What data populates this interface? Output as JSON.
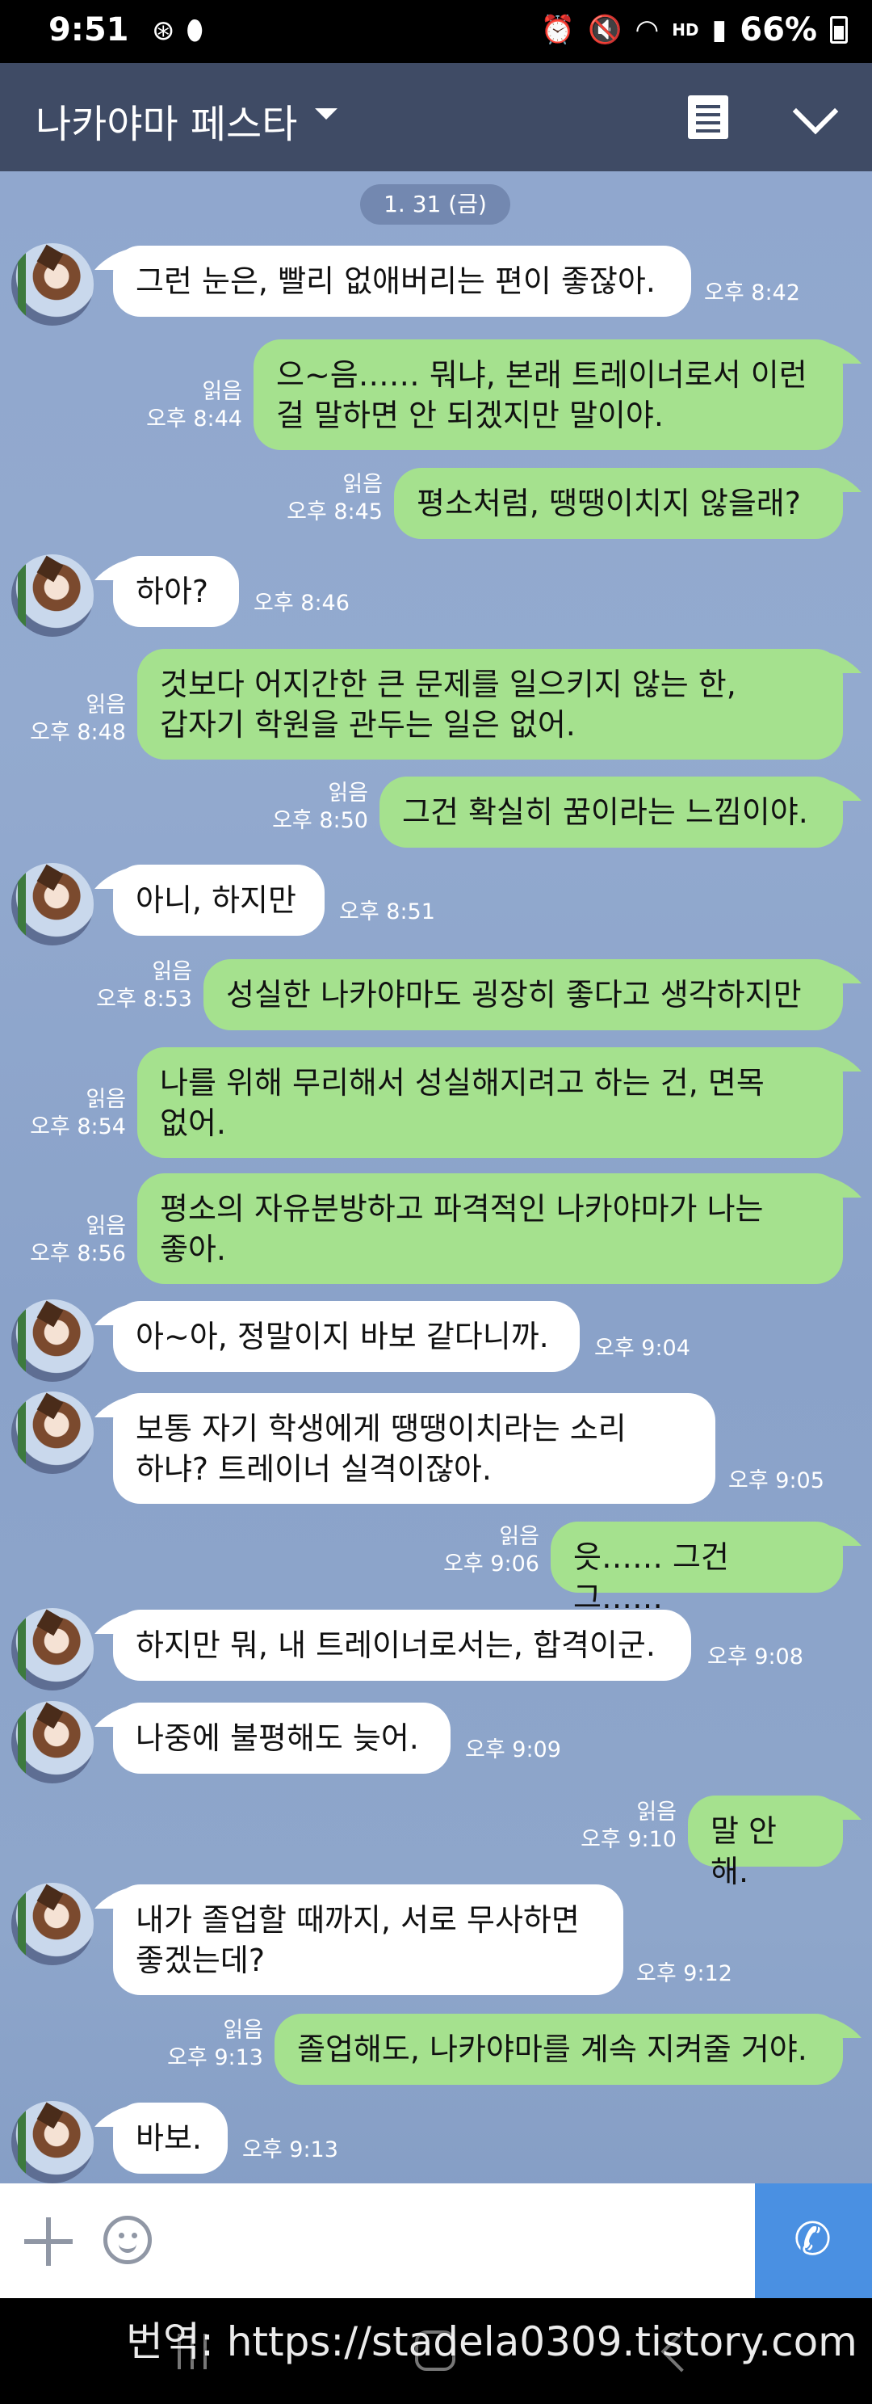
{
  "status_bar": {
    "time": "9:51",
    "left_icons": [
      "aperture-icon",
      "pill-icon"
    ],
    "right_icons": [
      "alarm-icon",
      "mute-icon",
      "wifi-icon",
      "hd-voice-icon",
      "signal-icon"
    ],
    "hd_label": "HD",
    "battery": "66%"
  },
  "header": {
    "title": "나카야마 페스타",
    "background": "#3f4b65"
  },
  "date_divider": "1. 31 (금)",
  "colors": {
    "incoming_bubble": "#ffffff",
    "outgoing_bubble": "#a5e18e",
    "call_button": "#4a90e2"
  },
  "messages": [
    {
      "dir": "in",
      "lines": [
        "그런 눈은, 빨리 없애버리는 편이 좋잖아."
      ],
      "time": "오후 8:42"
    },
    {
      "dir": "out",
      "lines": [
        "으~음…… 뭐냐, 본래 트레이너로서 이런",
        "걸 말하면 안 되겠지만 말이야."
      ],
      "read": "읽음",
      "time": "오후 8:44"
    },
    {
      "dir": "out",
      "lines": [
        "평소처럼, 땡땡이치지 않을래?"
      ],
      "read": "읽음",
      "time": "오후 8:45"
    },
    {
      "dir": "in",
      "lines": [
        "하아?"
      ],
      "time": "오후 8:46"
    },
    {
      "dir": "out",
      "lines": [
        "것보다 어지간한 큰 문제를 일으키지 않는 한,",
        "갑자기 학원을 관두는 일은 없어."
      ],
      "read": "읽음",
      "time": "오후 8:48"
    },
    {
      "dir": "out",
      "lines": [
        "그건 확실히 꿈이라는 느낌이야."
      ],
      "read": "읽음",
      "time": "오후 8:50"
    },
    {
      "dir": "in",
      "lines": [
        "아니, 하지만"
      ],
      "time": "오후 8:51"
    },
    {
      "dir": "out",
      "lines": [
        "성실한 나카야마도 굉장히 좋다고 생각하지만"
      ],
      "read": "읽음",
      "time": "오후 8:53"
    },
    {
      "dir": "out",
      "lines": [
        "나를 위해 무리해서 성실해지려고 하는 건, 면목",
        "없어."
      ],
      "read": "읽음",
      "time": "오후 8:54"
    },
    {
      "dir": "out",
      "lines": [
        "평소의 자유분방하고 파격적인 나카야마가 나는",
        "좋아."
      ],
      "read": "읽음",
      "time": "오후 8:56"
    },
    {
      "dir": "in",
      "lines": [
        "아~아, 정말이지 바보 같다니까."
      ],
      "time": "오후 9:04"
    },
    {
      "dir": "in",
      "lines": [
        "보통 자기 학생에게 땡땡이치라는 소리",
        "하냐? 트레이너 실격이잖아."
      ],
      "time": "오후 9:05"
    },
    {
      "dir": "out",
      "lines": [
        "읏…… 그건 그……"
      ],
      "read": "읽음",
      "time": "오후 9:06"
    },
    {
      "dir": "in",
      "lines": [
        "하지만 뭐, 내 트레이너로서는, 합격이군."
      ],
      "time": "오후 9:08"
    },
    {
      "dir": "in",
      "lines": [
        "나중에 불평해도 늦어."
      ],
      "time": "오후 9:09"
    },
    {
      "dir": "out",
      "lines": [
        "말 안 해."
      ],
      "read": "읽음",
      "time": "오후 9:10"
    },
    {
      "dir": "in",
      "lines": [
        "내가 졸업할 때까지, 서로 무사하면",
        "좋겠는데?"
      ],
      "time": "오후 9:12"
    },
    {
      "dir": "out",
      "lines": [
        "졸업해도, 나카야마를 계속 지켜줄 거야."
      ],
      "read": "읽음",
      "time": "오후 9:13"
    },
    {
      "dir": "in",
      "lines": [
        "바보."
      ],
      "time": "오후 9:13"
    }
  ],
  "watermark": "번역: https://stadela0309.tistory.com"
}
